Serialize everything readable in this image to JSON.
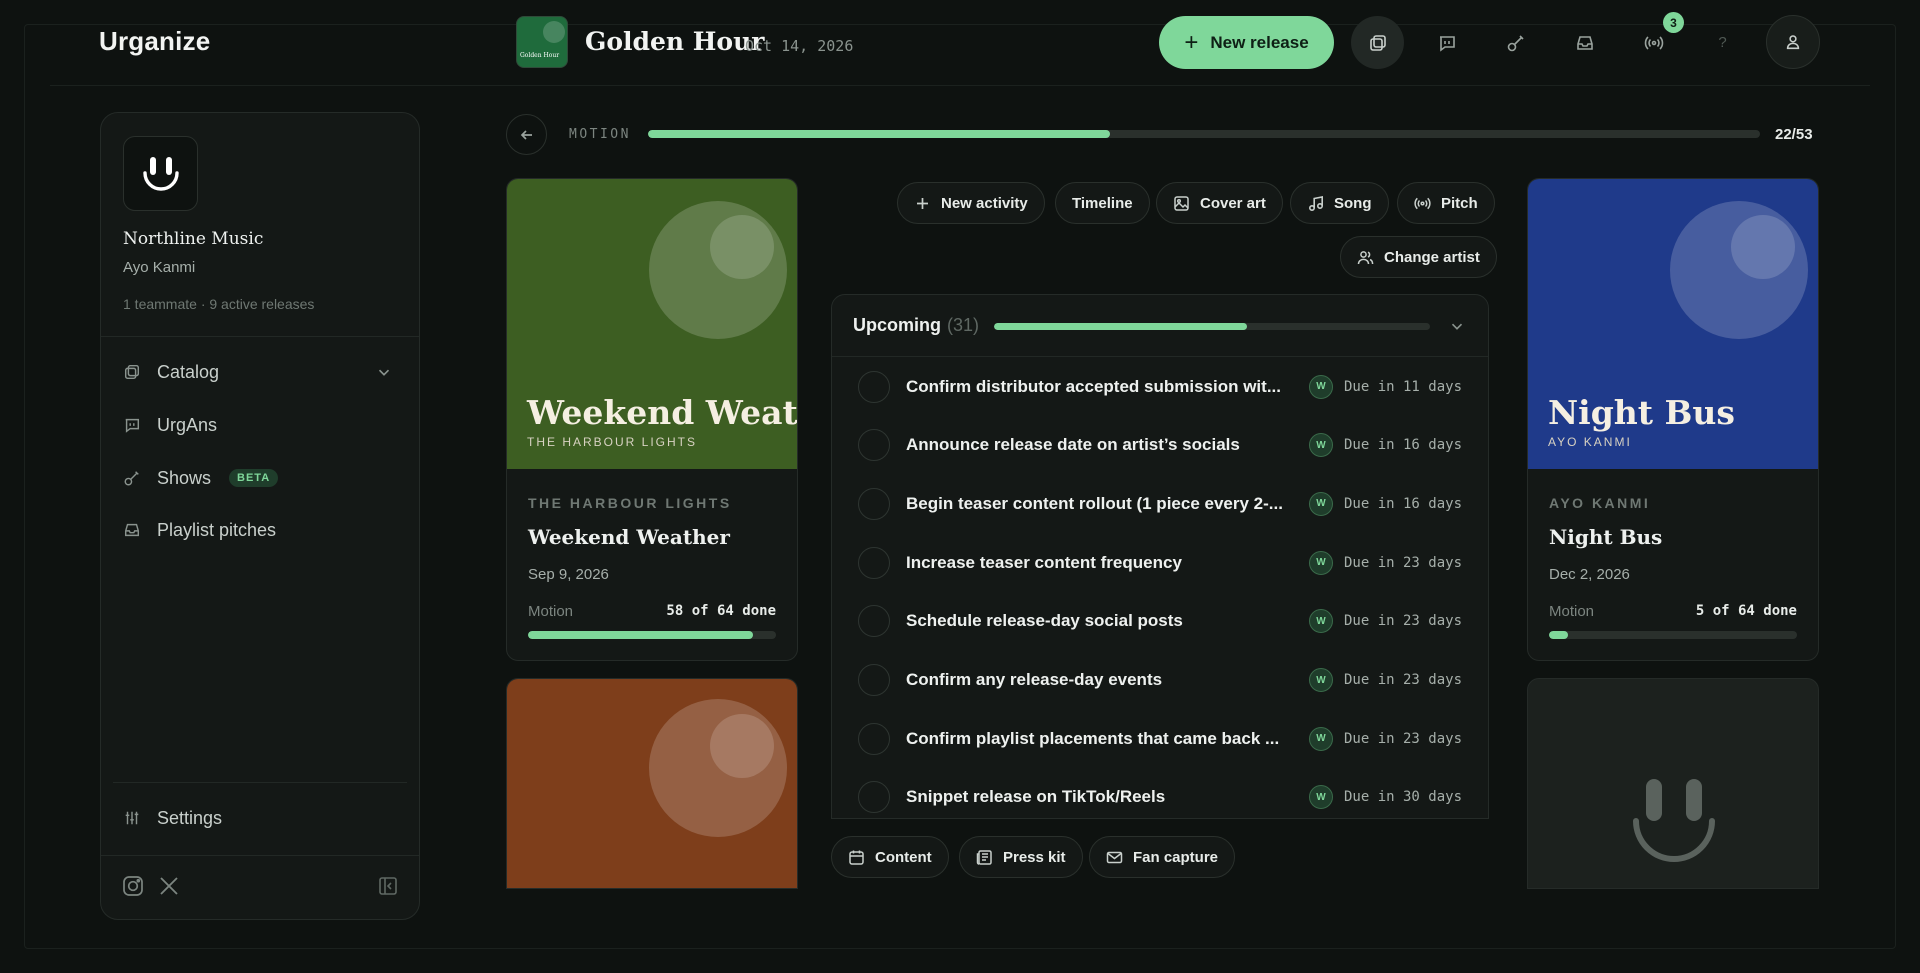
{
  "app": {
    "logo": "Urganize"
  },
  "header": {
    "release_thumb_title": "Golden Hour",
    "release_title": "Golden Hour",
    "release_date": "Oct 14, 2026",
    "new_release_label": "New release",
    "notification_count": "3",
    "help_label": "?"
  },
  "sidebar": {
    "org_name": "Northline Music",
    "user_name": "Ayo Kanmi",
    "meta": "1 teammate · 9 active releases",
    "items": [
      {
        "label": "Catalog",
        "icon": "catalog-icon"
      },
      {
        "label": "UrgAns",
        "icon": "chat-icon"
      },
      {
        "label": "Shows",
        "icon": "guitar-icon",
        "badge": "BETA"
      },
      {
        "label": "Playlist pitches",
        "icon": "inbox-icon"
      }
    ],
    "settings_label": "Settings"
  },
  "progress": {
    "label": "MOTION",
    "done": 22,
    "total": 53,
    "count_text": "22/53"
  },
  "cards": {
    "left": {
      "cover_title": "Weekend Weather",
      "cover_sub": "THE HARBOUR LIGHTS",
      "artist": "THE HARBOUR LIGHTS",
      "title": "Weekend Weather",
      "date": "Sep 9, 2026",
      "motion_label": "Motion",
      "done_text": "58 of 64 done",
      "progress": 0.906,
      "cover_color": "#3d5e22"
    },
    "right": {
      "cover_title": "Night Bus",
      "cover_sub": "AYO KANMI",
      "artist": "AYO KANMI",
      "title": "Night Bus",
      "date": "Dec 2, 2026",
      "motion_label": "Motion",
      "done_text": "5 of 64 done",
      "progress": 0.078,
      "cover_color": "#1f3a8a"
    },
    "left_bottom_cover_color": "#7e3e1b"
  },
  "actions": {
    "new_activity": "New activity",
    "timeline": "Timeline",
    "cover_art": "Cover art",
    "song": "Song",
    "pitch": "Pitch",
    "change_artist": "Change artist"
  },
  "upcoming": {
    "label": "Upcoming",
    "count": "(31)",
    "progress": 0.58,
    "tasks": [
      {
        "title": "Confirm distributor accepted submission wit...",
        "assignee": "W",
        "due": "Due in 11 days"
      },
      {
        "title": "Announce release date on artist’s socials",
        "assignee": "W",
        "due": "Due in 16 days"
      },
      {
        "title": "Begin teaser content rollout (1 piece every 2-...",
        "assignee": "W",
        "due": "Due in 16 days"
      },
      {
        "title": "Increase teaser content frequency",
        "assignee": "W",
        "due": "Due in 23 days"
      },
      {
        "title": "Schedule release-day social posts",
        "assignee": "W",
        "due": "Due in 23 days"
      },
      {
        "title": "Confirm any release-day events",
        "assignee": "W",
        "due": "Due in 23 days"
      },
      {
        "title": "Confirm playlist placements that came back ...",
        "assignee": "W",
        "due": "Due in 23 days"
      },
      {
        "title": "Snippet release on TikTok/Reels",
        "assignee": "W",
        "due": "Due in 30 days"
      }
    ]
  },
  "bottom_actions": {
    "content": "Content",
    "press_kit": "Press kit",
    "fan_capture": "Fan capture"
  },
  "colors": {
    "accent": "#7fd79a",
    "background": "#0e1210"
  }
}
